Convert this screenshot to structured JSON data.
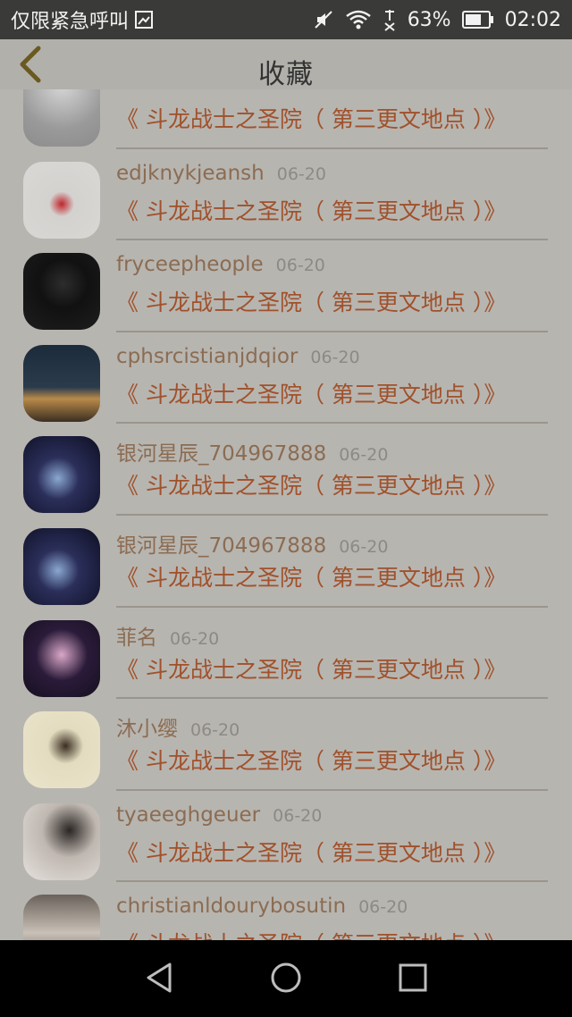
{
  "status_bar": {
    "carrier": "仅限紧急呼叫",
    "battery_percent": "63%",
    "time": "02:02",
    "icons": [
      "sim-icon",
      "mute-icon",
      "wifi-icon",
      "signal-off-icon",
      "battery-icon"
    ]
  },
  "header": {
    "title": "收藏",
    "back_icon": "chevron-left-icon",
    "accent_color": "#6a5a20"
  },
  "items": [
    {
      "user": "",
      "date": "",
      "title": "《 斗龙战士之圣院（ 第三更文地点 ）》",
      "avatar": "bag-image"
    },
    {
      "user": "edjknykjeansh",
      "date": "06-20",
      "title": "《 斗龙战士之圣院（ 第三更文地点 ）》",
      "avatar": "red-dress-girl-image"
    },
    {
      "user": "fryceepheople",
      "date": "06-20",
      "title": "《 斗龙战士之圣院（ 第三更文地点 ）》",
      "avatar": "boy-portrait-image"
    },
    {
      "user": "cphsrcistianjdqior",
      "date": "06-20",
      "title": "《 斗龙战士之圣院（ 第三更文地点 ）》",
      "avatar": "night-city-image"
    },
    {
      "user": "银河星辰_704967888",
      "date": "06-20",
      "title": "《 斗龙战士之圣院（ 第三更文地点 ）》",
      "avatar": "galaxy-image"
    },
    {
      "user": "银河星辰_704967888",
      "date": "06-20",
      "title": "《 斗龙战士之圣院（ 第三更文地点 ）》",
      "avatar": "galaxy-image"
    },
    {
      "user": "菲名",
      "date": "06-20",
      "title": "《 斗龙战士之圣院（ 第三更文地点 ）》",
      "avatar": "anime-girl-image"
    },
    {
      "user": "沐小缨",
      "date": "06-20",
      "title": "《 斗龙战士之圣院（ 第三更文地点 ）》",
      "avatar": "anime-floral-image"
    },
    {
      "user": "tyaeeghgeuer",
      "date": "06-20",
      "title": "《 斗龙战士之圣院（ 第三更文地点 ）》",
      "avatar": "woman-portrait-image"
    },
    {
      "user": "christianldourybosutin",
      "date": "06-20",
      "title": "《 斗龙战士之圣院（ 第三更文地点 ）》",
      "avatar": "sleeping-figure-image"
    }
  ],
  "nav_bar": {
    "back_icon": "triangle-back-icon",
    "home_icon": "circle-home-icon",
    "recents_icon": "square-recents-icon"
  }
}
